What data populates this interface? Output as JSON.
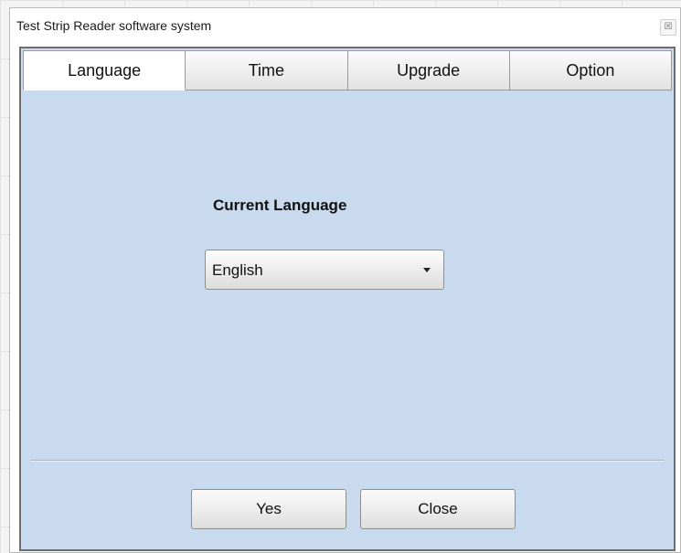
{
  "window": {
    "title": "Test Strip Reader software system",
    "close_glyph": "☒"
  },
  "tabs": [
    {
      "label": "Language",
      "active": true
    },
    {
      "label": "Time",
      "active": false
    },
    {
      "label": "Upgrade",
      "active": false
    },
    {
      "label": "Option",
      "active": false
    }
  ],
  "language_panel": {
    "heading": "Current Language",
    "selected_language": "English"
  },
  "buttons": {
    "yes": "Yes",
    "close": "Close"
  },
  "colors": {
    "panel_background": "#c9daee",
    "frame_border": "#6d6d6d"
  }
}
